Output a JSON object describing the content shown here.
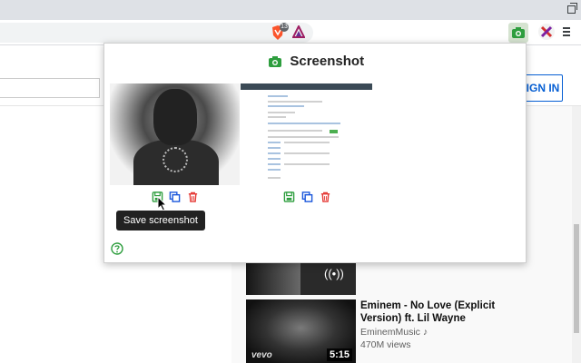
{
  "popup": {
    "title": "Screenshot",
    "tooltip": "Save screenshot",
    "shots": [
      {
        "actions": [
          "save-icon",
          "copy-icon",
          "trash-icon"
        ]
      },
      {
        "actions": [
          "save-icon",
          "copy-icon",
          "trash-icon"
        ]
      }
    ]
  },
  "toolbar": {
    "brave_badge": "13"
  },
  "page": {
    "sign_in": "SIGN IN",
    "video": {
      "title": "Eminem - No Love (Explicit Version) ft. Lil Wayne",
      "channel": "EminemMusic ♪",
      "views": "470M views",
      "duration": "5:15",
      "brand": "vevo"
    }
  },
  "colors": {
    "accent_green": "#2e9e3e",
    "copy_blue": "#1a56db",
    "delete_red": "#e53935",
    "yt_blue": "#065fd4"
  }
}
